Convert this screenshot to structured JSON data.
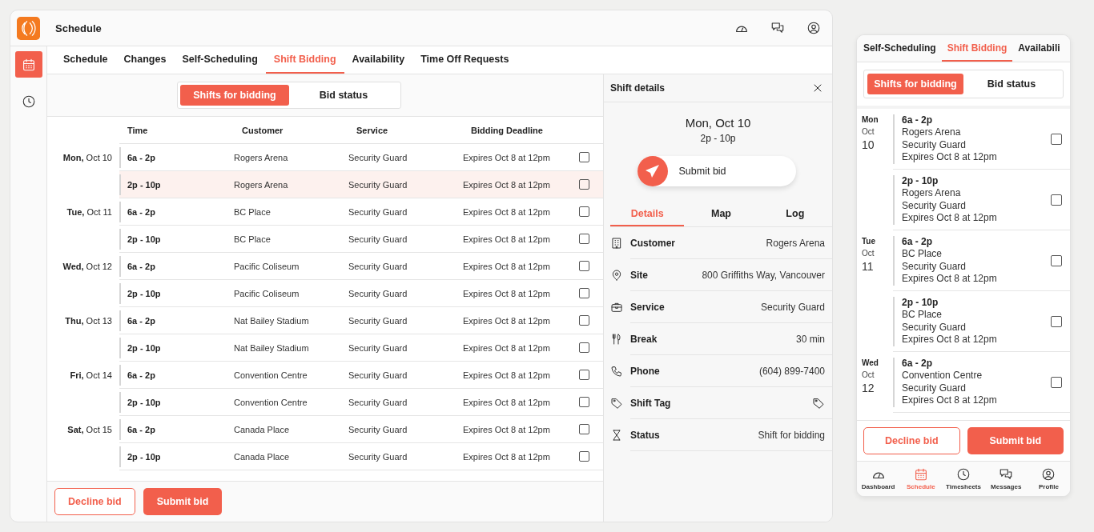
{
  "app": {
    "title": "Schedule"
  },
  "sidebar": {
    "items": [
      {
        "kind": "calendar",
        "selected": true
      },
      {
        "kind": "clock",
        "selected": false
      }
    ]
  },
  "tabs": [
    {
      "label": "Schedule",
      "selected": false
    },
    {
      "label": "Changes",
      "selected": false
    },
    {
      "label": "Self-Scheduling",
      "selected": false
    },
    {
      "label": "Shift Bidding",
      "selected": true
    },
    {
      "label": "Availability",
      "selected": false
    },
    {
      "label": "Time Off Requests",
      "selected": false
    }
  ],
  "segments": [
    {
      "label": "Shifts for bidding",
      "selected": true
    },
    {
      "label": "Bid status",
      "selected": false
    }
  ],
  "table": {
    "columns": [
      "Time",
      "Customer",
      "Service",
      "Bidding Deadline"
    ],
    "days": [
      {
        "date": "**Mon,** Oct 10",
        "shifts": [
          {
            "time": "6a - 2p",
            "customer": "Rogers Arena",
            "service": "Security Guard",
            "deadline": "Expires Oct 8 at 12pm",
            "checked": false,
            "selected": false
          },
          {
            "time": "2p - 10p",
            "customer": "Rogers Arena",
            "service": "Security Guard",
            "deadline": "Expires Oct 8 at 12pm",
            "checked": false,
            "selected": true
          }
        ]
      },
      {
        "date": "**Tue,** Oct 11",
        "shifts": [
          {
            "time": "6a - 2p",
            "customer": "BC Place",
            "service": "Security Guard",
            "deadline": "Expires Oct 8 at 12pm",
            "checked": false,
            "selected": false
          },
          {
            "time": "2p - 10p",
            "customer": "BC Place",
            "service": "Security Guard",
            "deadline": "Expires Oct 8 at 12pm",
            "checked": false,
            "selected": false
          }
        ]
      },
      {
        "date": "**Wed,** Oct 12",
        "shifts": [
          {
            "time": "6a - 2p",
            "customer": "Pacific Coliseum",
            "service": "Security Guard",
            "deadline": "Expires Oct 8 at 12pm",
            "checked": false,
            "selected": false
          },
          {
            "time": "2p - 10p",
            "customer": "Pacific Coliseum",
            "service": "Security Guard",
            "deadline": "Expires Oct 8 at 12pm",
            "checked": false,
            "selected": false
          }
        ]
      },
      {
        "date": "**Thu,** Oct 13",
        "shifts": [
          {
            "time": "6a - 2p",
            "customer": "Nat Bailey Stadium",
            "service": "Security Guard",
            "deadline": "Expires Oct 8 at 12pm",
            "checked": false,
            "selected": false
          },
          {
            "time": "2p - 10p",
            "customer": "Nat Bailey Stadium",
            "service": "Security Guard",
            "deadline": "Expires Oct 8 at 12pm",
            "checked": false,
            "selected": false
          }
        ]
      },
      {
        "date": "**Fri,** Oct 14",
        "shifts": [
          {
            "time": "6a - 2p",
            "customer": "Convention Centre",
            "service": "Security Guard",
            "deadline": "Expires Oct 8 at 12pm",
            "checked": false,
            "selected": false
          },
          {
            "time": "2p - 10p",
            "customer": "Convention Centre",
            "service": "Security Guard",
            "deadline": "Expires Oct 8 at 12pm",
            "checked": false,
            "selected": false
          }
        ]
      },
      {
        "date": "**Sat,** Oct 15",
        "shifts": [
          {
            "time": "6a - 2p",
            "customer": "Canada Place",
            "service": "Security Guard",
            "deadline": "Expires Oct 8 at 12pm",
            "checked": false,
            "selected": false
          },
          {
            "time": "2p - 10p",
            "customer": "Canada Place",
            "service": "Security Guard",
            "deadline": "Expires Oct 8 at 12pm",
            "checked": false,
            "selected": false
          }
        ]
      }
    ]
  },
  "actions": {
    "decline": "Decline bid",
    "submit": "Submit bid"
  },
  "details": {
    "title": "Shift details",
    "date": "Mon, Oct 10",
    "time": "2p - 10p",
    "submit": "Submit bid",
    "tabs": [
      {
        "label": "Details",
        "selected": true
      },
      {
        "label": "Map",
        "selected": false
      },
      {
        "label": "Log",
        "selected": false
      }
    ],
    "fields": [
      {
        "kind": "customer",
        "label": "Customer",
        "value": "Rogers Arena"
      },
      {
        "kind": "site",
        "label": "Site",
        "value": "800 Griffiths Way, Vancouver"
      },
      {
        "kind": "service",
        "label": "Service",
        "value": "Security Guard"
      },
      {
        "kind": "break",
        "label": "Break",
        "value": "30 min"
      },
      {
        "kind": "phone",
        "label": "Phone",
        "value": "(604) 899-7400"
      },
      {
        "kind": "tag",
        "label": "Shift Tag"
      },
      {
        "kind": "status",
        "label": "Status",
        "value": "Shift for bidding"
      }
    ]
  },
  "mobile": {
    "tabs": [
      {
        "label": "Self-Scheduling",
        "selected": false
      },
      {
        "label": "Shift Bidding",
        "selected": true
      },
      {
        "label": "Availabili",
        "selected": false
      }
    ],
    "segments": [
      {
        "label": "Shifts for bidding",
        "selected": true
      },
      {
        "label": "Bid status",
        "selected": false
      }
    ],
    "days": [
      {
        "weekday": "Mon",
        "month": "Oct",
        "day": "10",
        "shifts": [
          {
            "time": "6a - 2p",
            "customer": "Rogers Arena",
            "service": "Security Guard",
            "deadline": "Expires Oct 8 at 12pm",
            "checked": false
          },
          {
            "time": "2p - 10p",
            "customer": "Rogers Arena",
            "service": "Security Guard",
            "deadline": "Expires Oct 8 at 12pm",
            "checked": false
          }
        ]
      },
      {
        "weekday": "Tue",
        "month": "Oct",
        "day": "11",
        "shifts": [
          {
            "time": "6a - 2p",
            "customer": "BC Place",
            "service": "Security Guard",
            "deadline": "Expires Oct 8 at 12pm",
            "checked": false
          },
          {
            "time": "2p - 10p",
            "customer": "BC Place",
            "service": "Security Guard",
            "deadline": "Expires Oct 8 at 12pm",
            "checked": false
          }
        ]
      },
      {
        "weekday": "Wed",
        "month": "Oct",
        "day": "12",
        "shifts": [
          {
            "time": "6a - 2p",
            "customer": "Convention Centre",
            "service": "Security Guard",
            "deadline": "Expires Oct 8 at 12pm",
            "checked": false
          }
        ]
      }
    ],
    "decline": "Decline bid",
    "submit": "Submit bid",
    "nav": [
      {
        "kind": "dashboard",
        "label": "Dashboard",
        "selected": false
      },
      {
        "kind": "schedule",
        "label": "Schedule",
        "selected": true
      },
      {
        "kind": "timesheets",
        "label": "Timesheets",
        "selected": false
      },
      {
        "kind": "messages",
        "label": "Messages",
        "selected": false
      },
      {
        "kind": "profile",
        "label": "Profile",
        "selected": false
      }
    ]
  }
}
